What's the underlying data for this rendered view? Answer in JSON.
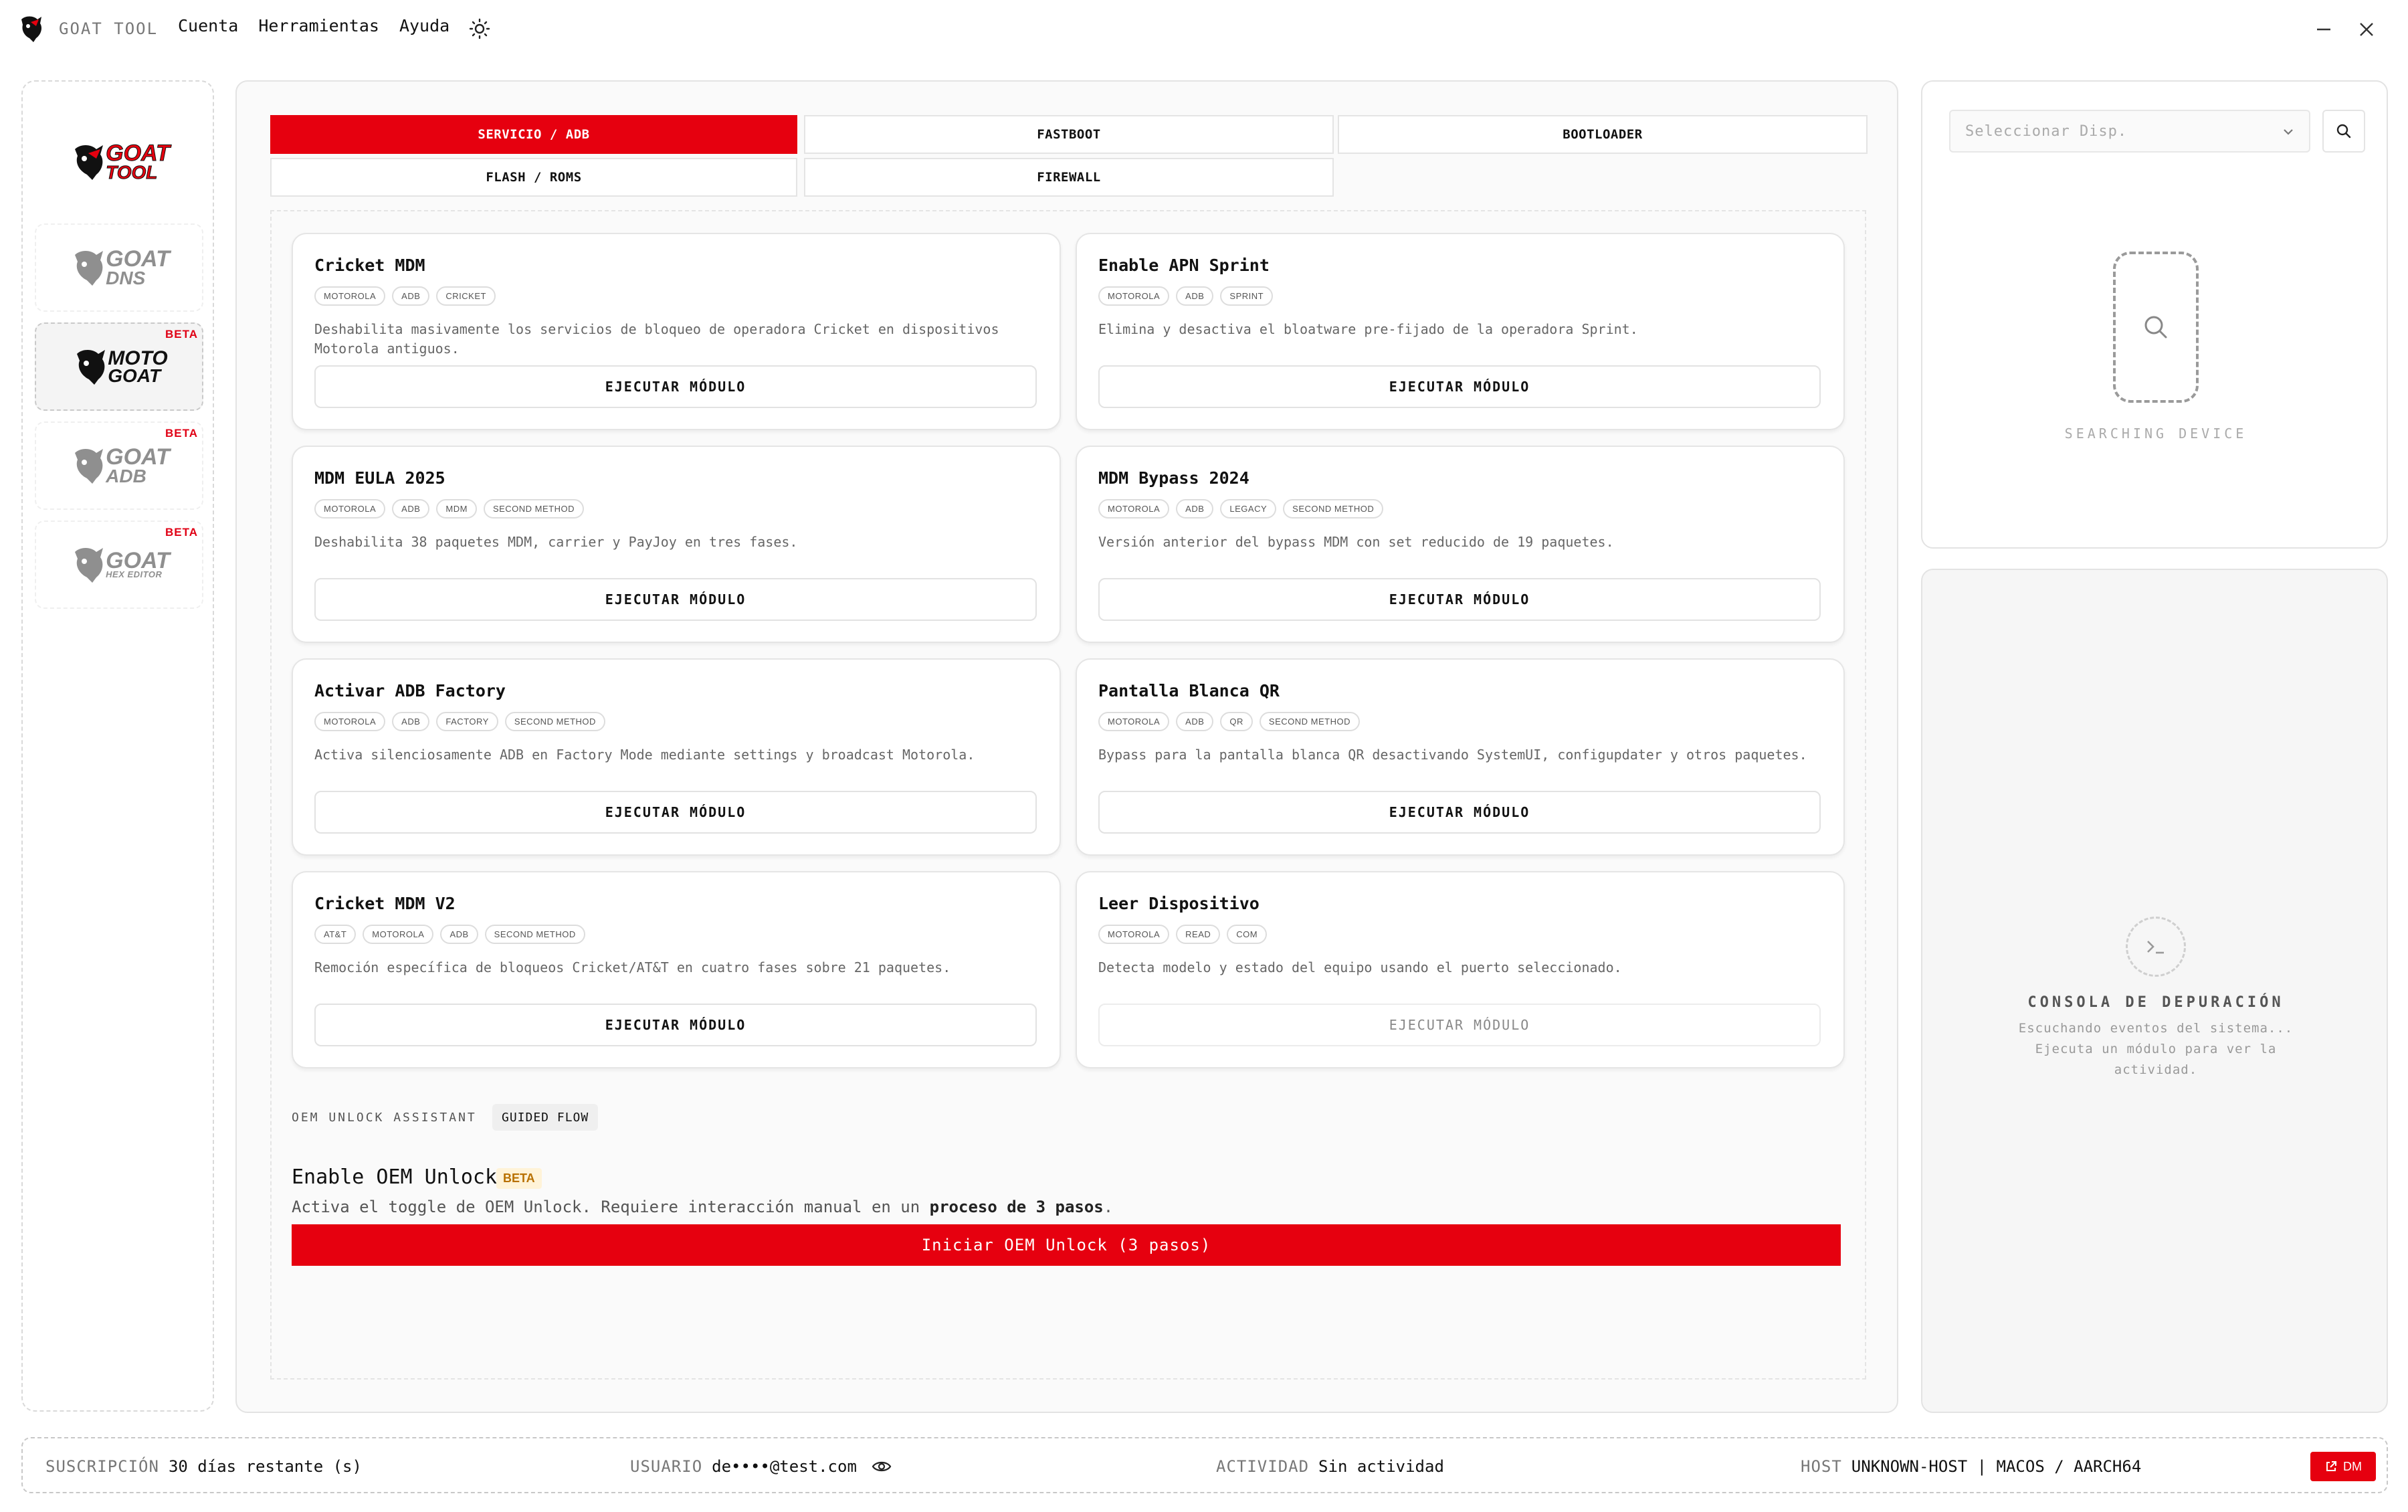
{
  "app": {
    "name": "GOAT TOOL"
  },
  "menu": {
    "cuenta": "Cuenta",
    "herramientas": "Herramientas",
    "ayuda": "Ayuda"
  },
  "sidebar": {
    "items": [
      {
        "l1": "GOAT",
        "l2": "TOOL",
        "l3": "",
        "beta": ""
      },
      {
        "l1": "GOAT",
        "l2": "DNS",
        "l3": "",
        "beta": ""
      },
      {
        "l1": "MOTO",
        "l2": "GOAT",
        "l3": "",
        "beta": "BETA"
      },
      {
        "l1": "GOAT",
        "l2": "ADB",
        "l3": "",
        "beta": "BETA"
      },
      {
        "l1": "GOAT",
        "l2": "",
        "l3": "HEX EDITOR",
        "beta": "BETA"
      }
    ]
  },
  "tabs": [
    "SERVICIO / ADB",
    "FASTBOOT",
    "BOOTLOADER",
    "FLASH / ROMS",
    "FIREWALL"
  ],
  "cards": [
    {
      "title": "Cricket MDM",
      "tags": [
        "MOTOROLA",
        "ADB",
        "CRICKET"
      ],
      "desc": "Deshabilita masivamente los servicios de bloqueo de operadora Cricket en dispositivos Motorola antiguos.",
      "button": "EJECUTAR MÓDULO"
    },
    {
      "title": "Enable APN Sprint",
      "tags": [
        "MOTOROLA",
        "ADB",
        "SPRINT"
      ],
      "desc": "Elimina y desactiva el bloatware pre-fijado de la operadora Sprint.",
      "button": "EJECUTAR MÓDULO"
    },
    {
      "title": "MDM EULA 2025",
      "tags": [
        "MOTOROLA",
        "ADB",
        "MDM",
        "SECOND METHOD"
      ],
      "desc": "Deshabilita 38 paquetes MDM, carrier y PayJoy en tres fases.",
      "button": "EJECUTAR MÓDULO"
    },
    {
      "title": "MDM Bypass 2024",
      "tags": [
        "MOTOROLA",
        "ADB",
        "LEGACY",
        "SECOND METHOD"
      ],
      "desc": "Versión anterior del bypass MDM con set reducido de 19 paquetes.",
      "button": "EJECUTAR MÓDULO"
    },
    {
      "title": "Activar ADB Factory",
      "tags": [
        "MOTOROLA",
        "ADB",
        "FACTORY",
        "SECOND METHOD"
      ],
      "desc": "Activa silenciosamente ADB en Factory Mode mediante settings y broadcast Motorola.",
      "button": "EJECUTAR MÓDULO"
    },
    {
      "title": "Pantalla Blanca QR",
      "tags": [
        "MOTOROLA",
        "ADB",
        "QR",
        "SECOND METHOD"
      ],
      "desc": "Bypass para la pantalla blanca QR desactivando SystemUI, configupdater y otros paquetes.",
      "button": "EJECUTAR MÓDULO"
    },
    {
      "title": "Cricket MDM V2",
      "tags": [
        "AT&T",
        "MOTOROLA",
        "ADB",
        "SECOND METHOD"
      ],
      "desc": "Remoción específica de bloqueos Cricket/AT&T en cuatro fases sobre 21 paquetes.",
      "button": "EJECUTAR MÓDULO"
    },
    {
      "title": "Leer Dispositivo",
      "tags": [
        "MOTOROLA",
        "READ",
        "COM"
      ],
      "desc": "Detecta modelo y estado del equipo usando el puerto seleccionado.",
      "button": "EJECUTAR MÓDULO"
    }
  ],
  "oem": {
    "section_label": "OEM UNLOCK ASSISTANT",
    "chip": "GUIDED FLOW",
    "title": "Enable OEM Unlock",
    "beta": "BETA",
    "desc_prefix": "Activa el toggle de OEM Unlock. Requiere interacción manual en un ",
    "desc_bold": "proceso de 3 pasos",
    "desc_suffix": ".",
    "button": "Iniciar OEM Unlock (3 pasos)"
  },
  "device": {
    "select_placeholder": "Seleccionar Disp.",
    "status": "SEARCHING DEVICE"
  },
  "console": {
    "title": "CONSOLA DE DEPURACIÓN",
    "subtitle": "Escuchando eventos del sistema... Ejecuta un módulo para ver la actividad."
  },
  "status": {
    "subscription_label": "SUSCRIPCIÓN",
    "subscription_value": "30 días restante (s)",
    "user_label": "USUARIO",
    "user_value": "de••••@test.com",
    "activity_label": "ACTIVIDAD",
    "activity_value": "Sin actividad",
    "host_label": "HOST",
    "host_value": "UNKNOWN-HOST | MACOS / AARCH64",
    "dm_button": "DM"
  },
  "colors": {
    "accent": "#e6000f",
    "beta_text": "#e00014"
  }
}
